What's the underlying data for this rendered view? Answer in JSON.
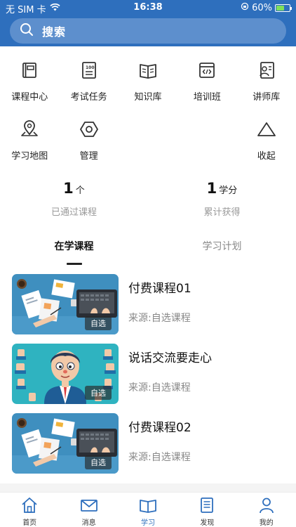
{
  "status": {
    "carrier": "无 SIM 卡",
    "time": "16:38",
    "battery_percent": "60%",
    "battery_level": 0.6
  },
  "search": {
    "placeholder": "搜索"
  },
  "grid": {
    "items": [
      {
        "label": "课程中心",
        "icon": "course-book-icon"
      },
      {
        "label": "考试任务",
        "icon": "exam-icon"
      },
      {
        "label": "知识库",
        "icon": "knowledge-book-icon"
      },
      {
        "label": "培训班",
        "icon": "training-class-icon"
      },
      {
        "label": "讲师库",
        "icon": "lecturer-icon"
      },
      {
        "label": "学习地图",
        "icon": "map-pin-icon"
      },
      {
        "label": "管理",
        "icon": "hexagon-settings-icon"
      },
      {
        "label": "收起",
        "icon": "triangle-collapse-icon"
      }
    ]
  },
  "stats": [
    {
      "value": "1",
      "unit": "个",
      "label": "已通过课程"
    },
    {
      "value": "1",
      "unit": "学分",
      "label": "累计获得"
    }
  ],
  "tabs": [
    {
      "label": "在学课程",
      "active": true
    },
    {
      "label": "学习计划",
      "active": false
    }
  ],
  "courses": [
    {
      "title": "付费课程01",
      "source": "来源:自选课程",
      "badge": "自选",
      "thumb": "desk-laptop-illustration"
    },
    {
      "title": "说话交流要走心",
      "source": "来源:自选课程",
      "badge": "自选",
      "thumb": "businessman-thumbs-up-illustration"
    },
    {
      "title": "付费课程02",
      "source": "来源:自选课程",
      "badge": "自选",
      "thumb": "desk-laptop-illustration"
    }
  ],
  "tabbar": [
    {
      "label": "首页",
      "icon": "home-icon",
      "active": false
    },
    {
      "label": "消息",
      "icon": "mail-icon",
      "active": false
    },
    {
      "label": "学习",
      "icon": "open-book-icon",
      "active": true
    },
    {
      "label": "发现",
      "icon": "document-icon",
      "active": false
    },
    {
      "label": "我的",
      "icon": "user-icon",
      "active": false
    }
  ],
  "colors": {
    "primary": "#2e6fbd",
    "search_bg": "#5d8fcd",
    "muted_text": "#888888"
  }
}
